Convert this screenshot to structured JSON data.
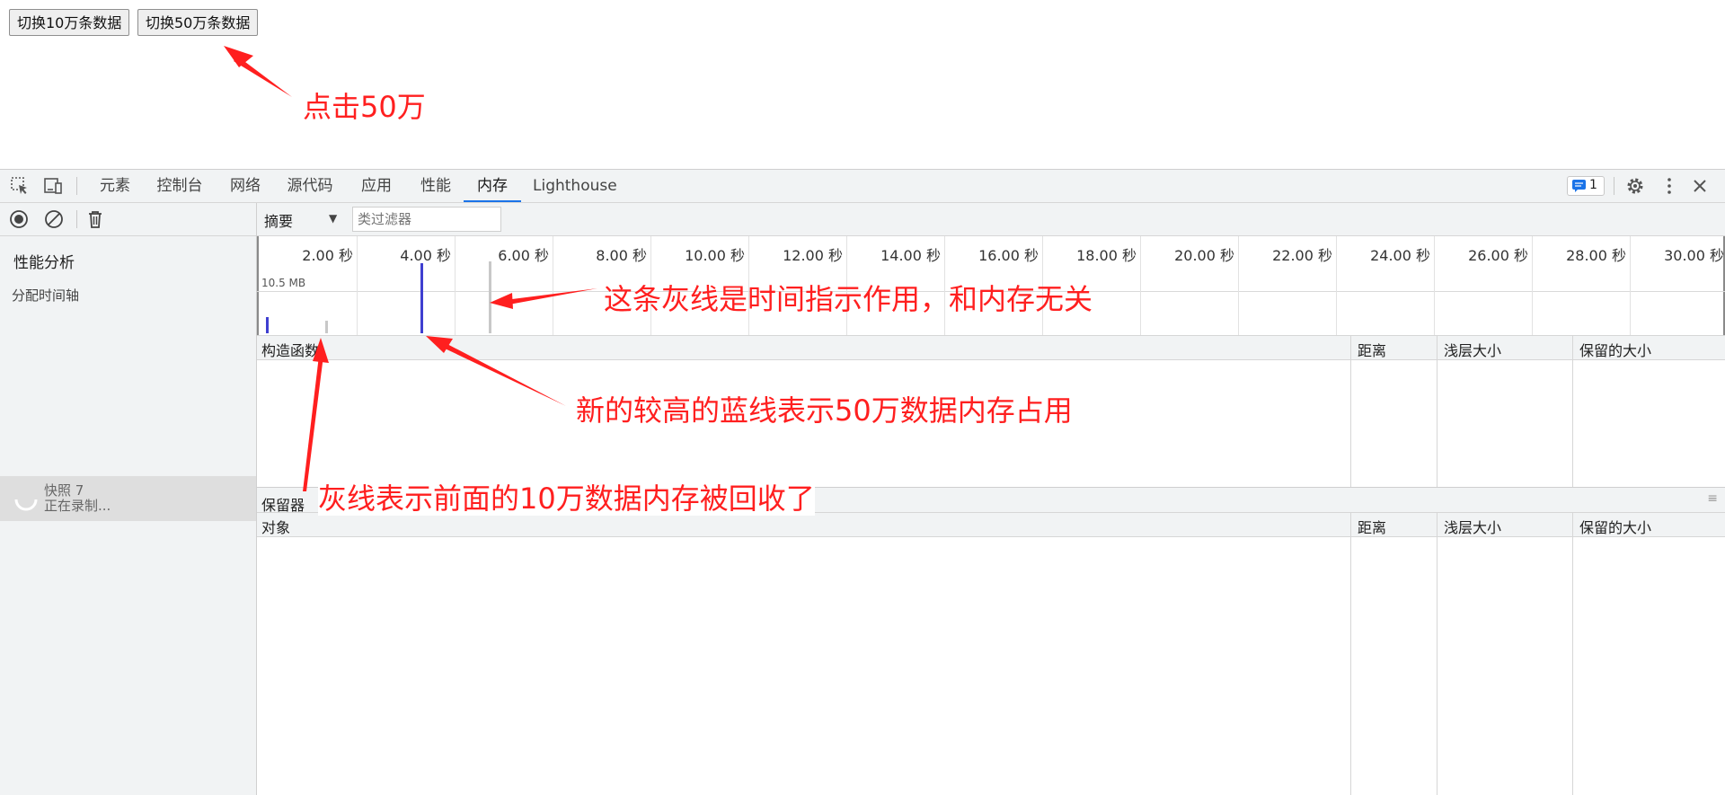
{
  "page": {
    "buttons": [
      "切换10万条数据",
      "切换50万条数据"
    ]
  },
  "annotations": {
    "click_50w": "点击50万",
    "gray_line_note": "这条灰线是时间指示作用，和内存无关",
    "blue_line_note": "新的较高的蓝线表示50万数据内存占用",
    "gray_lines_note": "灰线表示前面的10万数据内存被回收了"
  },
  "devtools": {
    "tabs": [
      "元素",
      "控制台",
      "网络",
      "源代码",
      "应用",
      "性能",
      "内存",
      "Lighthouse"
    ],
    "active_tab": "内存",
    "issues_count": "1",
    "sidebar": {
      "section_title": "性能分析",
      "subsection": "分配时间轴",
      "snapshot_name": "快照 7",
      "snapshot_status": "正在录制..."
    },
    "view_select": "摘要",
    "filter_placeholder": "类过滤器",
    "timeline": {
      "ticks": [
        "2.00 秒",
        "4.00 秒",
        "6.00 秒",
        "8.00 秒",
        "10.00 秒",
        "12.00 秒",
        "14.00 秒",
        "16.00 秒",
        "18.00 秒",
        "20.00 秒",
        "22.00 秒",
        "24.00 秒",
        "26.00 秒",
        "28.00 秒",
        "30.00 秒"
      ],
      "memory_label": "10.5 MB",
      "bars": [
        {
          "time_s": 0.1,
          "fraction": 0.23,
          "color": "#3f3fd0"
        },
        {
          "time_s": 1.3,
          "fraction": 0.18,
          "color": "#c8c8c8"
        },
        {
          "time_s": 3.25,
          "fraction": 0.97,
          "color": "#3f3fd0"
        },
        {
          "time_s": 4.65,
          "fraction": 1.0,
          "color": "#c8c8c8"
        }
      ]
    },
    "table1": {
      "headers": [
        "构造函数",
        "距离",
        "浅层大小",
        "保留的大小"
      ]
    },
    "retainers": {
      "title": "保留器",
      "headers": [
        "对象",
        "距离",
        "浅层大小",
        "保留的大小"
      ]
    }
  }
}
